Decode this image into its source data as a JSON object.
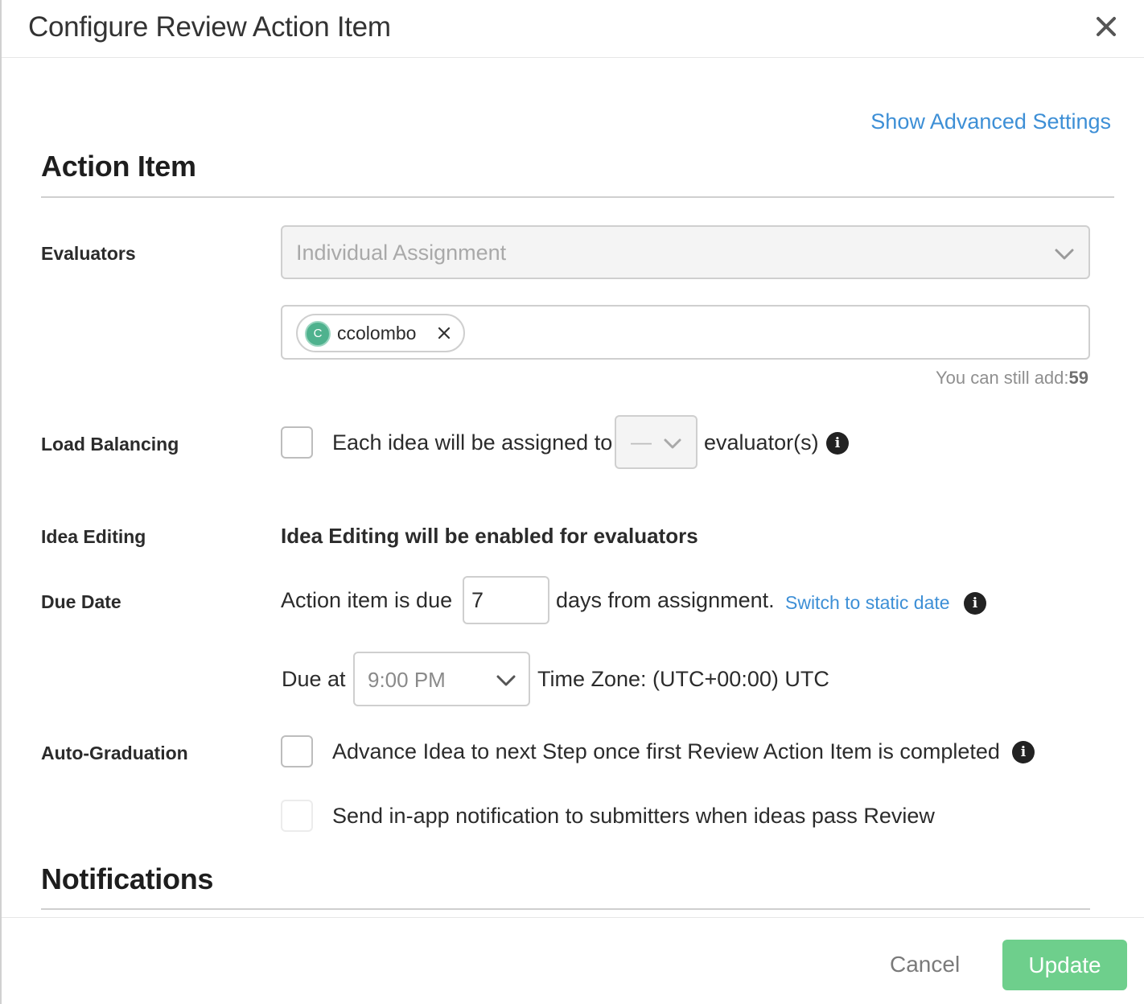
{
  "modal": {
    "title": "Configure Review Action Item"
  },
  "advanced_link": "Show Advanced Settings",
  "sections": {
    "action_item": "Action Item",
    "notifications": "Notifications"
  },
  "evaluators": {
    "label": "Evaluators",
    "assignment_value": "Individual Assignment",
    "tags": [
      {
        "initial": "C",
        "name": "ccolombo"
      }
    ],
    "hint_prefix": "You can still add:",
    "hint_count": "59"
  },
  "load_balancing": {
    "label": "Load Balancing",
    "checked": false,
    "text_before": "Each idea will be assigned to",
    "count_value": "—",
    "text_after": "evaluator(s)"
  },
  "idea_editing": {
    "label": "Idea Editing",
    "text": "Idea Editing will be enabled for evaluators"
  },
  "due_date": {
    "label": "Due Date",
    "text_before": "Action item is due",
    "days_value": "7",
    "text_after": "days from assignment.",
    "switch_link": "Switch to static date",
    "due_at_label": "Due at",
    "time_value": "9:00 PM",
    "timezone": "Time Zone: (UTC+00:00) UTC"
  },
  "auto_graduation": {
    "label": "Auto-Graduation",
    "advance_text": "Advance Idea to next Step once first Review Action Item is completed",
    "advance_checked": false,
    "notify_text": "Send in-app notification to submitters when ideas pass Review",
    "notify_checked": false
  },
  "footer": {
    "cancel_label": "Cancel",
    "update_label": "Update"
  },
  "colors": {
    "link": "#3d8fd6",
    "update_button": "#6ecf8c",
    "avatar": "#4fb28e"
  },
  "icons": [
    "close-icon",
    "chevron-down-icon",
    "remove-tag-icon",
    "info-icon"
  ]
}
